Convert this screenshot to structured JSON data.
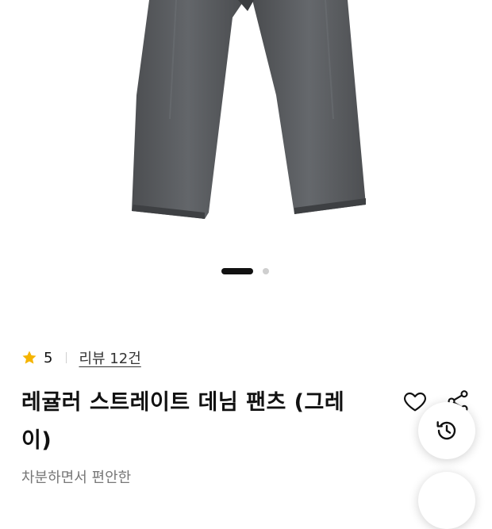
{
  "product": {
    "rating_value": "5",
    "reviews_label": "리뷰 12건",
    "title": "레귤러 스트레이트 데님 팬츠 (그레이)",
    "subtitle": "차분하면서 편안한"
  },
  "carousel": {
    "current_index": 1,
    "total": 2
  },
  "icons": {
    "rating": "star-icon",
    "wishlist": "heart-icon",
    "share": "share-icon",
    "recent_history": "history-icon"
  },
  "colors": {
    "star": "#f5b400",
    "denim": "#57595c",
    "text": "#111111",
    "muted": "#777777"
  }
}
